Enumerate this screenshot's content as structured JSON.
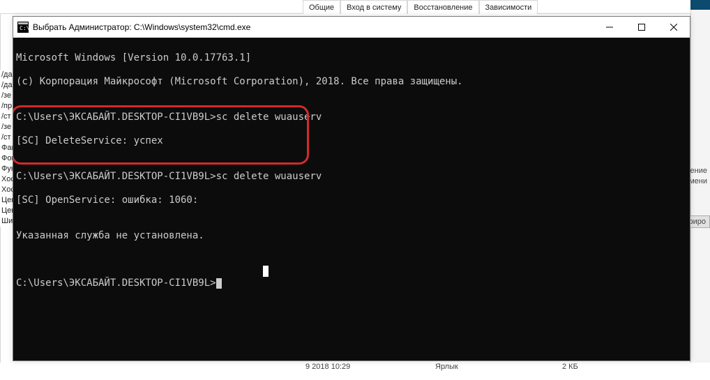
{
  "bg_tabs": [
    "Общие",
    "Вход в систему",
    "Восстановление",
    "Зависимости"
  ],
  "bg_left_items": [
    "/да",
    "/да",
    "/зе",
    "/пр",
    "/ст",
    "/зе",
    "/ст",
    "Фак",
    "Фон",
    "Фун",
    "Хос",
    "Хос",
    "Цен",
    "Цен",
    "Шиф"
  ],
  "bg_right_fragments": {
    "a": "мение",
    "b": "мени",
    "btn": "риро"
  },
  "title": "Выбрать Администратор: C:\\Windows\\system32\\cmd.exe",
  "terminal": {
    "l1": "Microsoft Windows [Version 10.0.17763.1]",
    "l2": "(c) Корпорация Майкрософт (Microsoft Corporation), 2018. Все права защищены.",
    "blank": "",
    "p1": "C:\\Users\\ЭКСАБАЙТ.DESKTOP-CI1VB9L>sc delete wuauserv",
    "p1r": "[SC] DeleteService: успех",
    "p2": "C:\\Users\\ЭКСАБАЙТ.DESKTOP-CI1VB9L>sc delete wuauserv",
    "p2r": "[SC] OpenService: ошибка: 1060:",
    "p2m": "Указанная служба не установлена.",
    "p3": "C:\\Users\\ЭКСАБАЙТ.DESKTOP-CI1VB9L>"
  },
  "bottom": {
    "date": "9 2018 10:29",
    "type": "Ярлык",
    "size": "2 КБ"
  }
}
